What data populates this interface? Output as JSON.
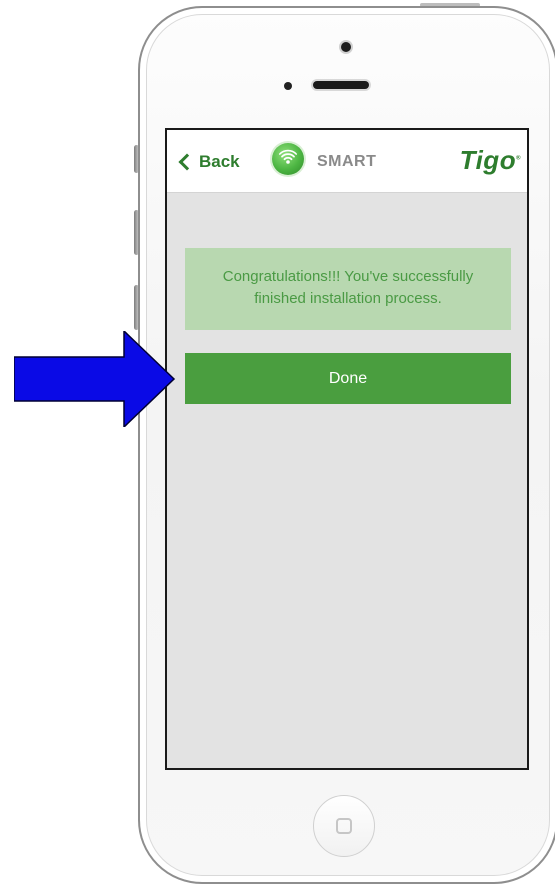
{
  "nav": {
    "back_label": "Back",
    "app_name": "SMART",
    "brand": "Tigo"
  },
  "main": {
    "message": "Congratulations!!! You've successfully finished installation process.",
    "done_label": "Done"
  },
  "colors": {
    "brand_green": "#2e7d2e",
    "button_green": "#4a9e3f",
    "message_bg": "#b8d8b0",
    "screen_bg": "#e3e3e3",
    "arrow_blue": "#0a0ae6"
  },
  "icons": {
    "back": "chevron-left-icon",
    "smart": "wifi-signal-icon",
    "annotation": "right-arrow-icon"
  }
}
